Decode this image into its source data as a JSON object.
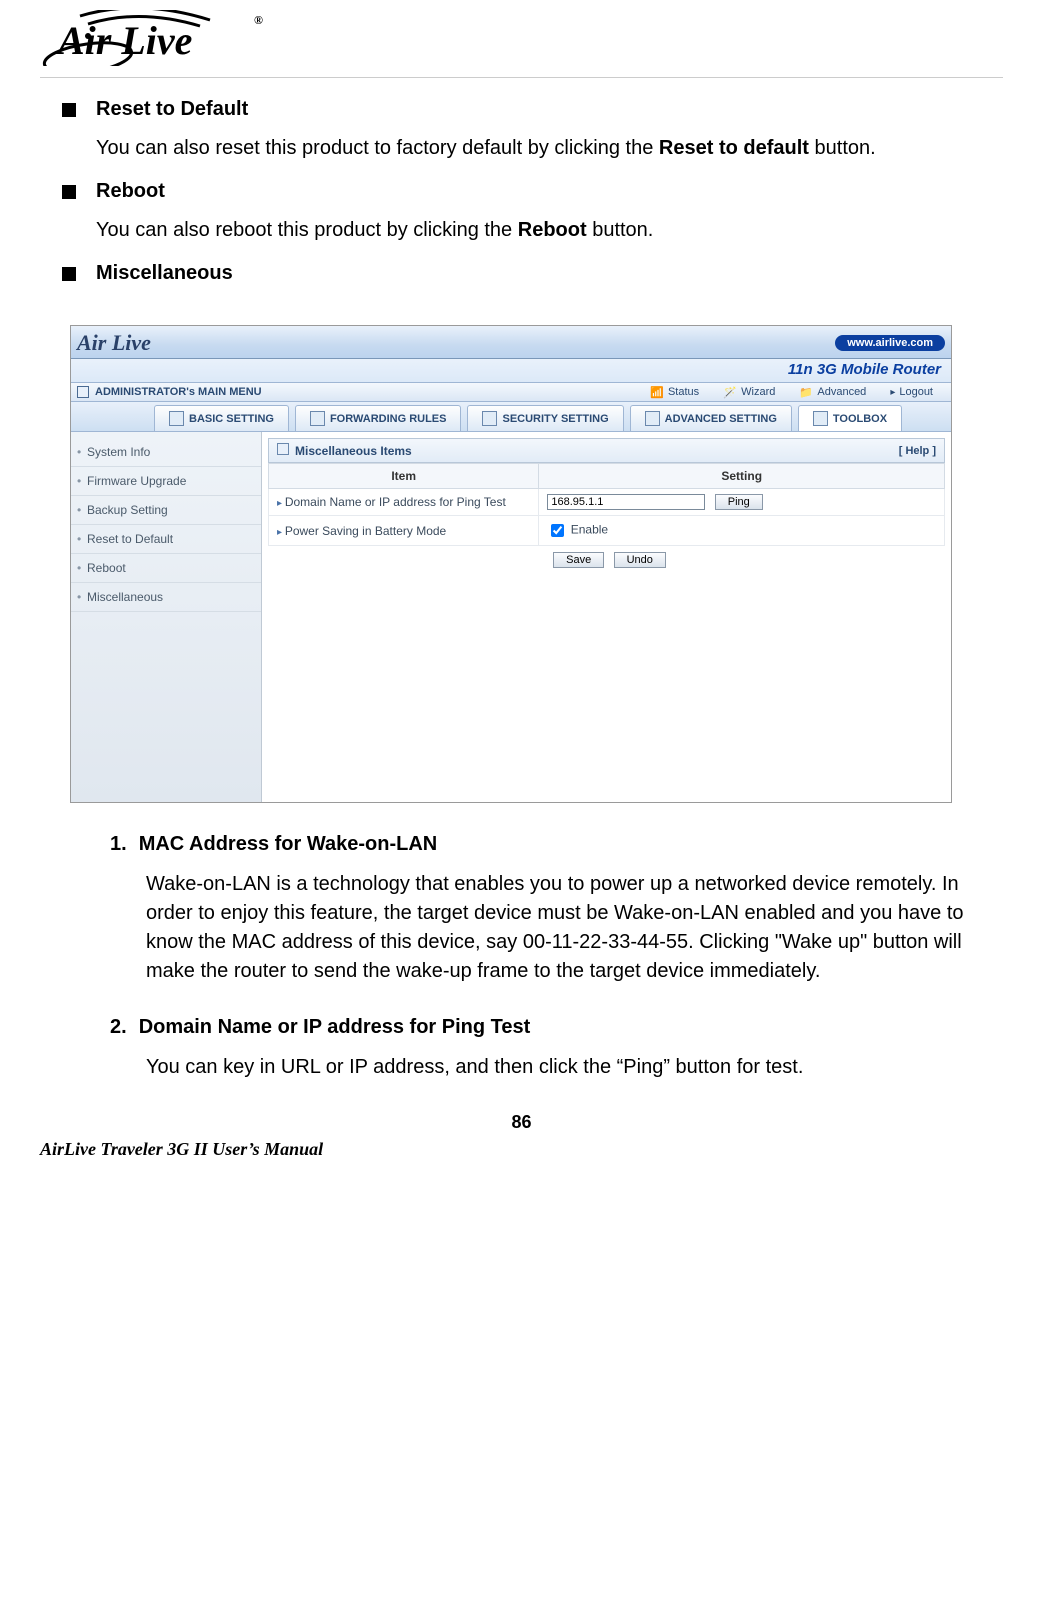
{
  "logo_brand": "Air Live",
  "sections": {
    "reset_title": "Reset to Default",
    "reset_body_a": "You can also reset this product to factory default by clicking the ",
    "reset_body_bold": "Reset to default",
    "reset_body_b": " button.",
    "reboot_title": "Reboot",
    "reboot_body_a": "You can also reboot this product by clicking the ",
    "reboot_body_bold": "Reboot",
    "reboot_body_b": " button.",
    "misc_title": "Miscellaneous"
  },
  "screenshot": {
    "brand": "Air Live",
    "url_pill": "www.airlive.com",
    "router_title": "11n 3G Mobile Router",
    "main_menu_title": "ADMINISTRATOR's MAIN MENU",
    "menu": {
      "status": "Status",
      "wizard": "Wizard",
      "advanced": "Advanced",
      "logout": "Logout"
    },
    "tabs": {
      "basic": "BASIC SETTING",
      "forwarding": "FORWARDING RULES",
      "security": "SECURITY SETTING",
      "advanced": "ADVANCED SETTING",
      "toolbox": "TOOLBOX"
    },
    "sidebar": [
      "System Info",
      "Firmware Upgrade",
      "Backup Setting",
      "Reset to Default",
      "Reboot",
      "Miscellaneous"
    ],
    "panel": {
      "title": "Miscellaneous Items",
      "help": "[ Help ]",
      "col_item": "Item",
      "col_setting": "Setting",
      "row1_label": "Domain Name or IP address for Ping Test",
      "row1_value": "168.95.1.1",
      "ping_btn": "Ping",
      "row2_label": "Power Saving in Battery Mode",
      "row2_chk_label": "Enable",
      "save_btn": "Save",
      "undo_btn": "Undo"
    }
  },
  "numbered": {
    "n1_num": "1.",
    "n1_title": "MAC Address for Wake-on-LAN",
    "n1_body": "Wake-on-LAN is a technology that enables you to power up a networked device remotely. In order to enjoy this feature, the target device must be Wake-on-LAN enabled and you have to know the MAC address of this device, say 00-11-22-33-44-55. Clicking \"Wake up\" button will make the router to send the wake-up frame to the target device immediately.",
    "n2_num": "2.",
    "n2_title": "Domain Name or IP address for Ping Test",
    "n2_body": "You can key in URL or IP address, and then click the “Ping” button for test."
  },
  "page_number": "86",
  "footer": "AirLive Traveler 3G II User’s Manual"
}
